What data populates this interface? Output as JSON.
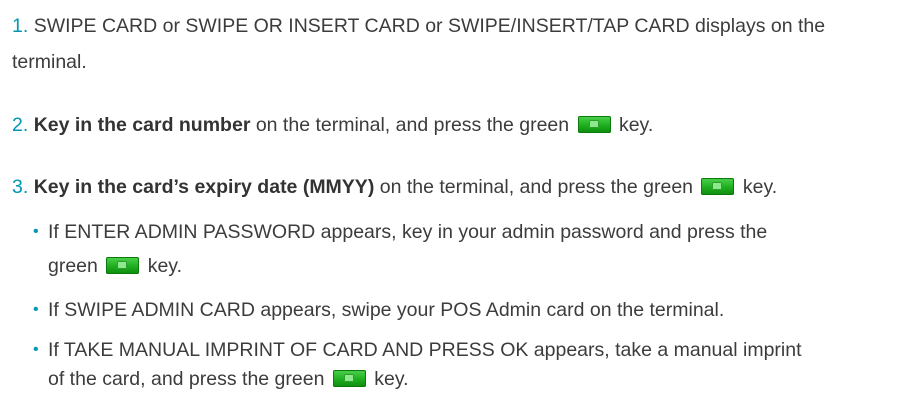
{
  "steps": [
    {
      "num": "1.",
      "line1": "SWIPE CARD or SWIPE OR INSERT CARD or SWIPE/INSERT/TAP CARD displays on the",
      "line2": "terminal."
    },
    {
      "num": "2.",
      "bold": "Key in the card number",
      "text": " on the terminal, and press the green",
      "after": " key."
    },
    {
      "num": "3.",
      "bold": "Key in the card’s expiry date (MMYY)",
      "text": " on the terminal, and press the green",
      "after": " key."
    }
  ],
  "bullets": [
    {
      "line1": "If ENTER ADMIN PASSWORD appears, key in your admin password and press the",
      "line2_pre": "green",
      "line2_post": " key."
    },
    {
      "line1": "If SWIPE ADMIN CARD appears, swipe your POS Admin card on the terminal."
    },
    {
      "line1": "If TAKE MANUAL IMPRINT OF CARD AND PRESS OK appears, take a manual imprint",
      "line2_pre": "of the card, and press the green",
      "line2_post": " key."
    }
  ],
  "icons": {
    "green_key": "green-enter-key-icon"
  },
  "colors": {
    "number": "#0096b4",
    "key_green": "#1fae1f",
    "text": "#3c3c3c"
  }
}
